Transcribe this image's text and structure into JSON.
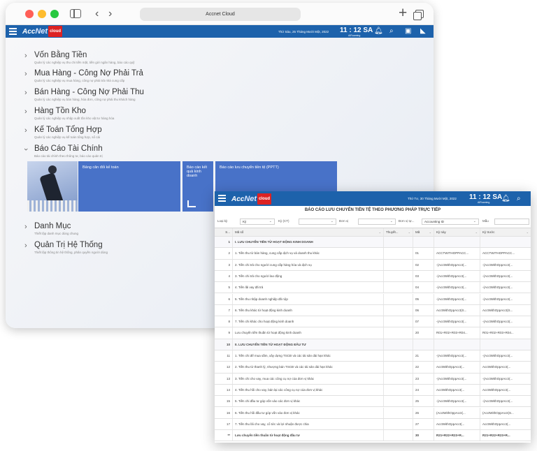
{
  "browser": {
    "address": "Accnet Cloud",
    "back_icon": "‹",
    "forward_icon": "›",
    "new_tab_icon": "+"
  },
  "appbar": {
    "logo_prefix": "Acc",
    "logo_mid": "Net",
    "logo_box": "cloud",
    "date": "Thứ Sáu, 25 Tháng Mười Một, 2022",
    "time": "11 : 12 SA",
    "time_sub": "AIRoaming"
  },
  "menu": [
    {
      "title": "Vốn Bằng Tiền",
      "sub": "Quản lý các nghiệp vụ thu chi tiền mặt, tiền gửi ngân hàng, báo cáo quỹ"
    },
    {
      "title": "Mua Hàng - Công Nợ Phải Trả",
      "sub": "Quản lý các nghiệp vụ mua hàng, công nợ phải trả nhà cung cấp"
    },
    {
      "title": "Bán Hàng - Công Nợ Phải Thu",
      "sub": "Quản lý các nghiệp vụ bán hàng, hóa đơn, công nợ phải thu khách hàng"
    },
    {
      "title": "Hàng Tồn Kho",
      "sub": "Quản lý các nghiệp vụ nhập xuất tồn kho vật tư hàng hóa"
    },
    {
      "title": "Kế Toán Tổng Hợp",
      "sub": "Quản lý các nghiệp vụ kế toán tổng hợp, sổ cái"
    },
    {
      "title": "Báo Cáo Tài Chính",
      "sub": "Báo cáo tài chính theo thông tư, báo cáo quản trị"
    }
  ],
  "menu_bottom": [
    {
      "title": "Danh Mục",
      "sub": "Thiết lập danh mục dùng chung"
    },
    {
      "title": "Quản Trị Hệ Thống",
      "sub": "Thiết lập thông tin hệ thống, phân quyền người dùng"
    }
  ],
  "tiles": {
    "balance": "Bảng cân đối kế toán",
    "income": "Báo cáo kết quả kinh doanh",
    "cashflow": "Báo cáo lưu chuyển tiền tệ (PPTT)"
  },
  "report": {
    "title": "BÁO CÁO LƯU CHUYỂN TIỀN TỆ THEO PHƯƠNG PHÁP TRỰC TIẾP",
    "date": "Thứ Tư, 30 Tháng Mười Một, 2022",
    "time": "11 : 12 SA",
    "time_sub": "AIRoaming",
    "filters": {
      "type_label": "Loại kỳ",
      "type_value": "Kỳ",
      "period_label": "Kỳ (CT)",
      "unit_label": "Đơn vị",
      "unit_label2": "Đơn vị tự...",
      "unit_value": "Accounting ID",
      "sample_label": "Mẫu"
    },
    "headers": [
      "S...",
      "Mã số",
      "Thuyết...",
      "Mã",
      "Kỳ này",
      "Kỳ trước"
    ],
    "rows": [
      {
        "n": "1",
        "name": "I. LƯU CHUYỂN TIỀN TỪ HOẠT ĐỘNG KINH DOANH",
        "code": "",
        "cur": "",
        "prev": "",
        "bold": true
      },
      {
        "n": "2",
        "name": "1. Tiền thu từ bán hàng, cung cấp dịch vụ và doanh thu khác",
        "code": "01",
        "cur": "ACCTWITHOPPACC...",
        "prev": "ACCTWITHOPPACC..."
      },
      {
        "n": "3",
        "name": "2. Tiền chi trả cho người cung cấp hàng hóa và dịch vụ",
        "code": "02",
        "cur": "-(AcctWithOppAcct(...",
        "prev": "-(AcctWithOppAcct(..."
      },
      {
        "n": "4",
        "name": "3. Tiền chi trả cho người lao động",
        "code": "03",
        "cur": "-(AcctWithOppAcct(...",
        "prev": "-(AcctWithOppAcct(..."
      },
      {
        "n": "5",
        "name": "4. Tiền lãi vay đã trả",
        "code": "04",
        "cur": "-(AcctWithOppAcct(...",
        "prev": "-(AcctWithOppAcct(..."
      },
      {
        "n": "6",
        "name": "5. Tiền thu nhập doanh nghiệp đã nộp",
        "code": "05",
        "cur": "-(AcctWithOppAcct(...",
        "prev": "-(AcctWithOppAcct(..."
      },
      {
        "n": "7",
        "name": "6. Tiền thu khác từ hoạt động kinh doanh",
        "code": "06",
        "cur": "AcctWithOppAcct(S...",
        "prev": "AcctWithOppAcct(S..."
      },
      {
        "n": "8",
        "name": "7. Tiền chi khác cho hoạt động kinh doanh",
        "code": "07",
        "cur": "-(AcctWithOppAcct(...",
        "prev": "-(AcctWithOppAcct(..."
      },
      {
        "n": "9",
        "name": "Lưu chuyển tiền thuần từ hoạt động kinh doanh",
        "code": "20",
        "cur": "R01+R02+R03+R04...",
        "prev": "R01+R02+R03+R04..."
      },
      {
        "n": "10",
        "name": "II. LƯU CHUYỂN TIỀN TỪ HOẠT ĐỘNG ĐẦU TƯ",
        "code": "",
        "cur": "",
        "prev": "",
        "bold": true
      },
      {
        "n": "11",
        "name": "1. Tiền chi để mua sắm, xây dựng TSCĐ và các tài sản dài hạn khác",
        "code": "21",
        "cur": "-(AcctWithOppAcct(...",
        "prev": "-(AcctWithOppAcct(..."
      },
      {
        "n": "12",
        "name": "2. Tiền thu từ thanh lý, nhượng bán TSCĐ và các tài sản dài hạn khác",
        "code": "22",
        "cur": "AcctWithOppAcct(...",
        "prev": "AcctWithOppAcct(..."
      },
      {
        "n": "13",
        "name": "3. Tiền chi cho vay, mua các công cụ nợ của đơn vị khác",
        "code": "23",
        "cur": "-(AcctWithOppAcct(...",
        "prev": "-(AcctWithOppAcct(..."
      },
      {
        "n": "14",
        "name": "4. Tiền thu hồi cho vay, bán lại các công cụ nợ của đơn vị khác",
        "code": "24",
        "cur": "AcctWithOppAcct(...",
        "prev": "AcctWithOppAcct(..."
      },
      {
        "n": "15",
        "name": "5. Tiền chi đầu tư góp vốn vào các đơn vị khác",
        "code": "25",
        "cur": "-(AcctWithOppAcct(...",
        "prev": "-(AcctWithOppAcct(..."
      },
      {
        "n": "16",
        "name": "6. Tiền thu hồi đầu tư góp vốn vào đơn vị khác",
        "code": "26",
        "cur": "(AcctWithOppAcct(...",
        "prev": "(AcctWithOppAcct(S..."
      },
      {
        "n": "17",
        "name": "7. Tiền thu lãi cho vay, cổ tức và lợi nhuận được chia",
        "code": "27",
        "cur": "AcctWithOppAcct(...",
        "prev": "AcctWithOppAcct(..."
      },
      {
        "n": "**",
        "name": "Lưu chuyển tiền thuần từ hoạt động đầu tư",
        "code": "30",
        "cur": "R21+R22+R23+R...",
        "prev": "R21+R22+R23+R...",
        "bold": true
      }
    ]
  }
}
